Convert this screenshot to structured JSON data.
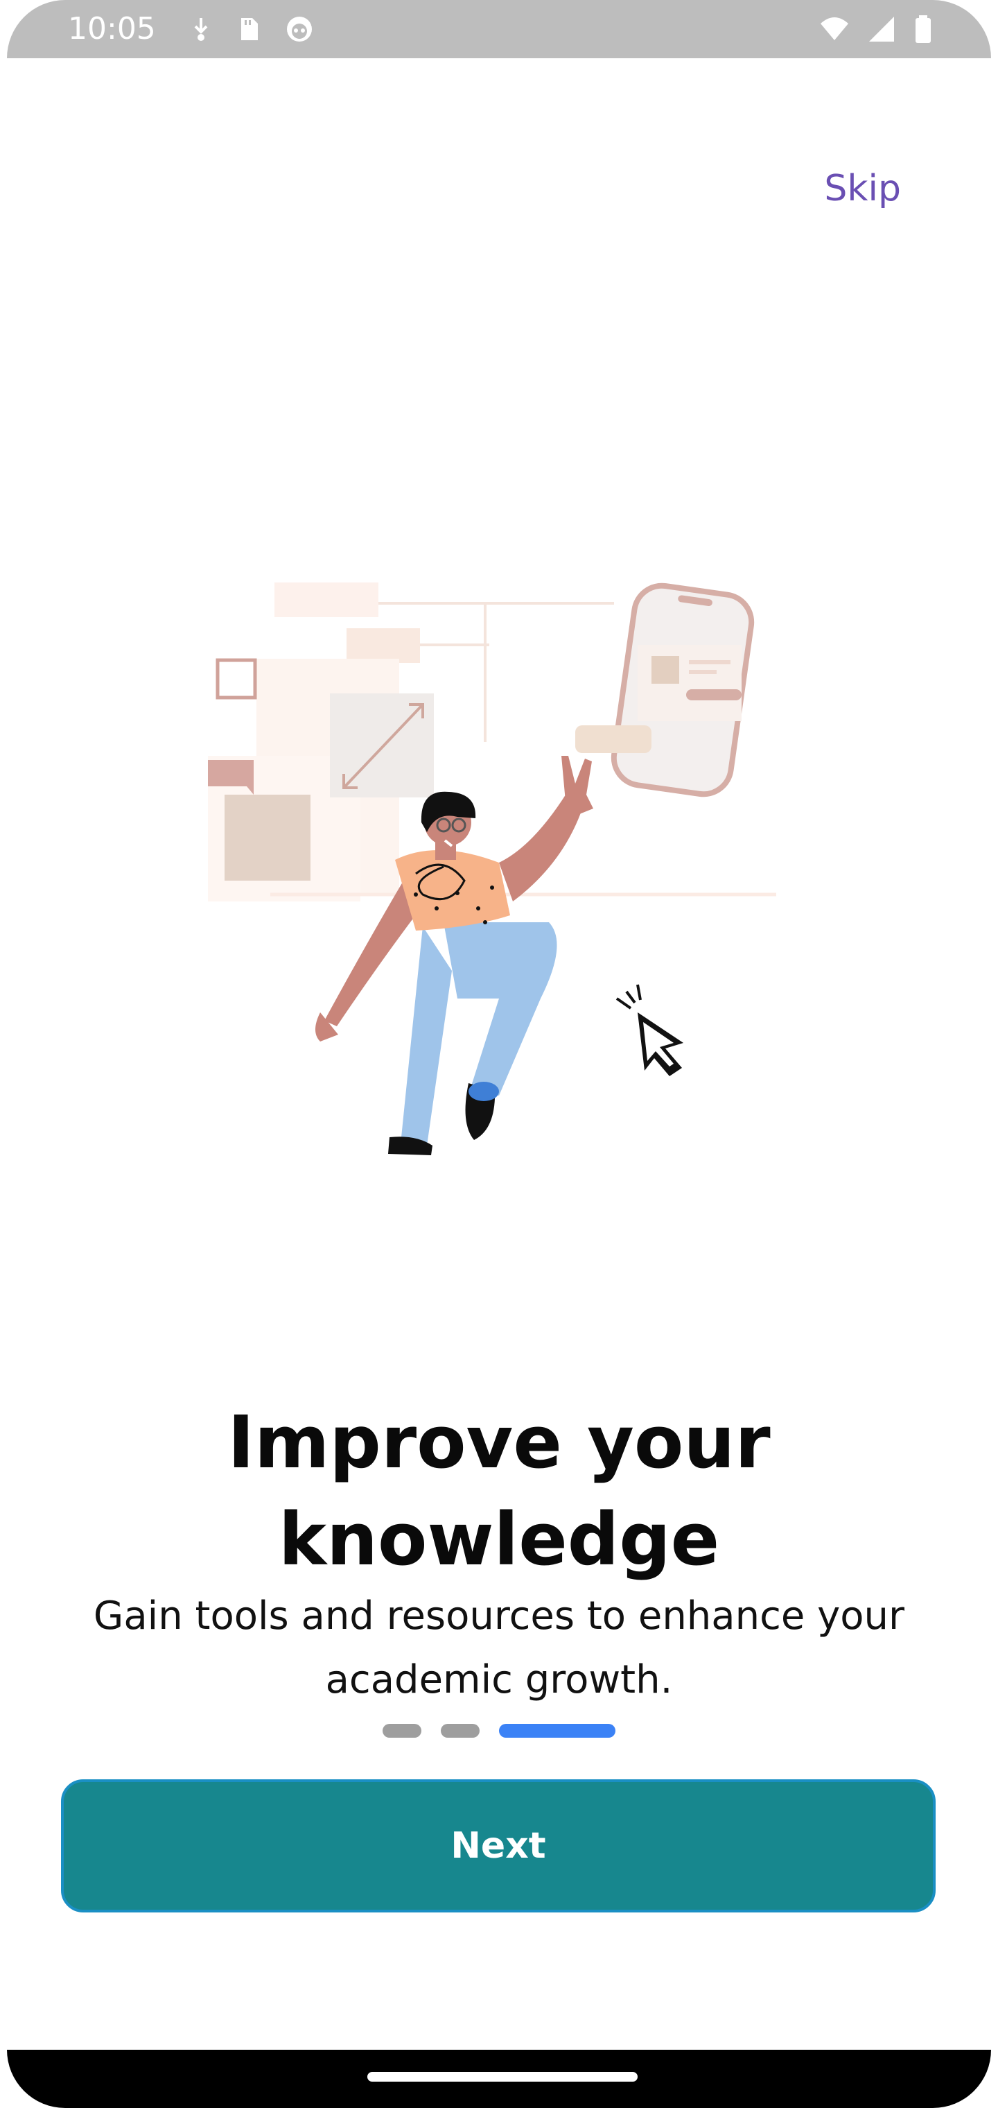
{
  "status_bar": {
    "time": "10:05",
    "icons_left": [
      "download-icon",
      "sd-card-icon",
      "robot-icon"
    ],
    "icons_right": [
      "wifi-icon",
      "cellular-signal-icon",
      "battery-icon"
    ]
  },
  "header": {
    "skip_label": "Skip"
  },
  "illustration": {
    "name": "person-with-phone-and-cursor-illustration"
  },
  "content": {
    "title_line1": "Improve your",
    "title_line2": "knowledge",
    "subtitle_line1": "Gain tools and resources to enhance your",
    "subtitle_line2": "academic growth."
  },
  "pagination": {
    "total": 3,
    "active_index": 2
  },
  "actions": {
    "next_label": "Next"
  },
  "colors": {
    "accent_button": "#17878e",
    "button_border": "#1a8fc4",
    "skip_text": "#6a4fb3",
    "dot_active": "#3b82f6",
    "dot_inactive": "#9e9e9e"
  }
}
